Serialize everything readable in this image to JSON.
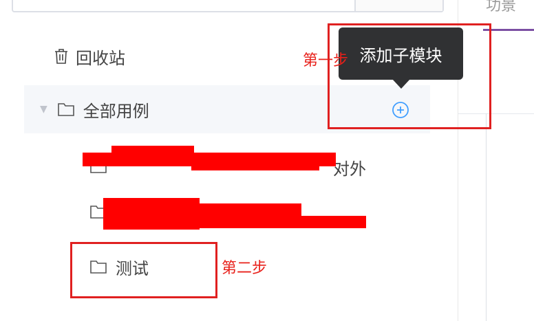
{
  "tree": {
    "trash_label": "回收站",
    "all_cases_label": "全部用例",
    "sub_item_1_visible": "对外",
    "sub_item_2_visible": "",
    "test_folder_label": "测试"
  },
  "tooltip": {
    "text": "添加子模块"
  },
  "annotations": {
    "step1": "第一步",
    "step2": "第二步"
  },
  "right_panel": {
    "tab_partial": "功景"
  },
  "icons": {
    "trash": "trash-icon",
    "folder": "folder-icon",
    "caret": "caret-down-icon",
    "add": "plus-circle-icon"
  },
  "colors": {
    "annotation_red": "#e02020",
    "tooltip_bg": "#303133",
    "accent_blue": "#409eff",
    "tab_underline": "#7b4ea3"
  }
}
